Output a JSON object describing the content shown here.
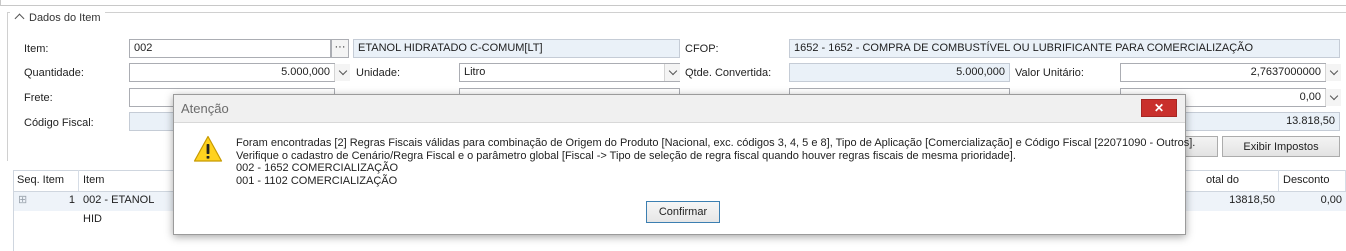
{
  "section": {
    "title": "Dados do Item"
  },
  "fields": {
    "item_label": "Item:",
    "item_code": "002",
    "item_lookup": "···",
    "item_desc": "ETANOL HIDRATADO C-COMUM[LT]",
    "cfop_label": "CFOP:",
    "cfop_value": "1652 - 1652 - COMPRA DE COMBUSTÍVEL OU LUBRIFICANTE PARA COMERCIALIZAÇÃO",
    "quantidade_label": "Quantidade:",
    "quantidade_value": "5.000,000",
    "unidade_label": "Unidade:",
    "unidade_value": "Litro",
    "qtde_convertida_label": "Qtde. Convertida:",
    "qtde_convertida_value": "5.000,000",
    "valor_unitario_label": "Valor Unitário:",
    "valor_unitario_value": "2,7637000000",
    "frete_label": "Frete:",
    "row3_right_value": "0,00",
    "codigo_fiscal_label": "Código Fiscal:",
    "row4_right_value": "13.818,50"
  },
  "buttons": {
    "exibir_impostos": "Exibir Impostos"
  },
  "grid": {
    "headers": {
      "seq": "Seq. Item",
      "item": "Item",
      "total": "otal do Produto",
      "desconto": "Desconto"
    },
    "rows": [
      {
        "expand": "⊞",
        "seq": "1",
        "item": "002 - ETANOL HID",
        "total": "13818,50",
        "desconto": "0,00"
      }
    ]
  },
  "dialog": {
    "title": "Atenção",
    "close": "✕",
    "lines": [
      "Foram encontradas [2] Regras Fiscais válidas para combinação de Origem do Produto [Nacional, exc. códigos 3, 4, 5 e 8], Tipo de Aplicação [Comercialização] e Código Fiscal [22071090 - Outros].",
      "Verifique o cadastro de Cenário/Regra Fiscal e o parâmetro global [Fiscal -> Tipo de seleção de regra fiscal quando houver regras fiscais de mesma prioridade].",
      "002 - 1652 COMERCIALIZAÇÃO",
      "001 - 1102 COMERCIALIZAÇÃO"
    ],
    "confirm": "Confirmar",
    "icon": "warning-icon"
  }
}
